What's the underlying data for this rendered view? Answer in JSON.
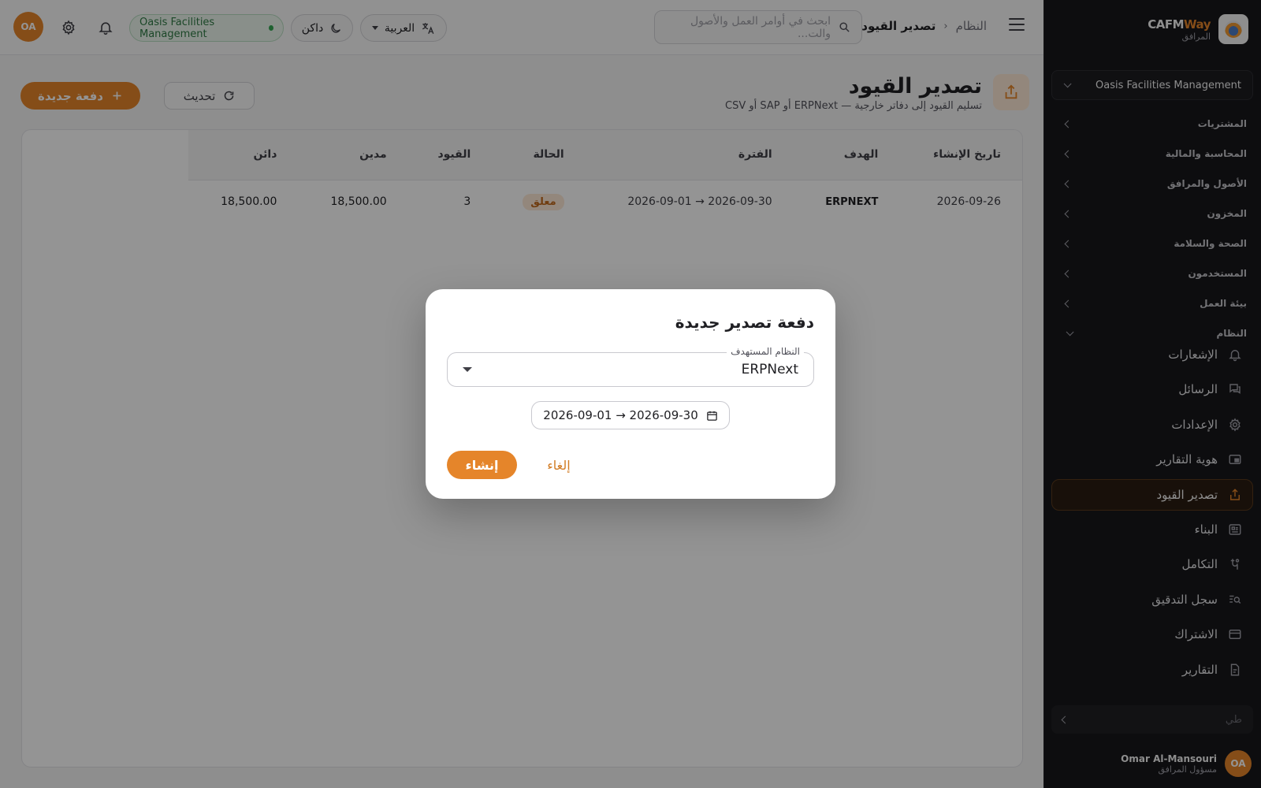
{
  "brand": {
    "name_part1": "CAFM",
    "name_part2": "Way",
    "subtitle": "المرافق"
  },
  "sidebar": {
    "org_selector": "Oasis Facilities Management",
    "groups": [
      {
        "label": "المشتريات"
      },
      {
        "label": "المحاسبة والمالية"
      },
      {
        "label": "الأصول والمرافق"
      },
      {
        "label": "المخزون"
      },
      {
        "label": "الصحة والسلامة"
      },
      {
        "label": "المستخدمون"
      },
      {
        "label": "بيئة العمل"
      },
      {
        "label": "النظام"
      }
    ],
    "items": [
      {
        "label": "الإشعارات",
        "icon": "bell-icon"
      },
      {
        "label": "الرسائل",
        "icon": "messages-icon"
      },
      {
        "label": "الإعدادات",
        "icon": "gear-icon"
      },
      {
        "label": "هوية التقارير",
        "icon": "report-branding-icon"
      },
      {
        "label": "تصدير القيود",
        "icon": "export-icon"
      },
      {
        "label": "البناء",
        "icon": "builder-icon"
      },
      {
        "label": "التكامل",
        "icon": "integration-icon"
      },
      {
        "label": "سجل التدقيق",
        "icon": "audit-search-icon"
      },
      {
        "label": "الاشتراك",
        "icon": "credit-card-icon"
      },
      {
        "label": "التقارير",
        "icon": "reports-icon"
      }
    ],
    "collapse_label": "طي",
    "user": {
      "name": "Omar Al-Mansouri",
      "role": "مسؤول المرافق",
      "initials": "OA"
    }
  },
  "topbar": {
    "breadcrumb_parent": "النظام",
    "breadcrumb_current": "تصدير القيود",
    "search_placeholder": "ابحث في أوامر العمل والأصول والت...",
    "language": "العربية",
    "theme": "داكن",
    "org_badge": "Oasis Facilities Management",
    "avatar_initials": "OA"
  },
  "page": {
    "title": "تصدير القيود",
    "subtitle": "تسليم القيود إلى دفاتر خارجية — ERPNext أو SAP أو CSV",
    "new_batch_label": "دفعة جديدة",
    "refresh_label": "تحديث"
  },
  "table": {
    "headers": {
      "created": "تاريخ الإنشاء",
      "target": "الهدف",
      "period": "الفترة",
      "status": "الحالة",
      "entries": "القيود",
      "debit": "مدين",
      "credit": "دائن"
    },
    "rows": [
      {
        "created": "2026-09-26",
        "target": "ERPNEXT",
        "period": "2026-09-01 → 2026-09-30",
        "status": "معلق",
        "entries": "3",
        "debit": "18,500.00",
        "credit": "18,500.00"
      }
    ]
  },
  "modal": {
    "title": "دفعة تصدير جديدة",
    "target_label": "النظام المستهدف",
    "target_value": "ERPNext",
    "date_range": "2026-09-01 → 2026-09-30",
    "create_label": "إنشاء",
    "cancel_label": "إلغاء"
  },
  "colors": {
    "accent": "#e5852a",
    "sidebar_bg": "#18181b",
    "status_pending_bg": "#fde9d6",
    "org_badge_green": "#2f7a45"
  }
}
